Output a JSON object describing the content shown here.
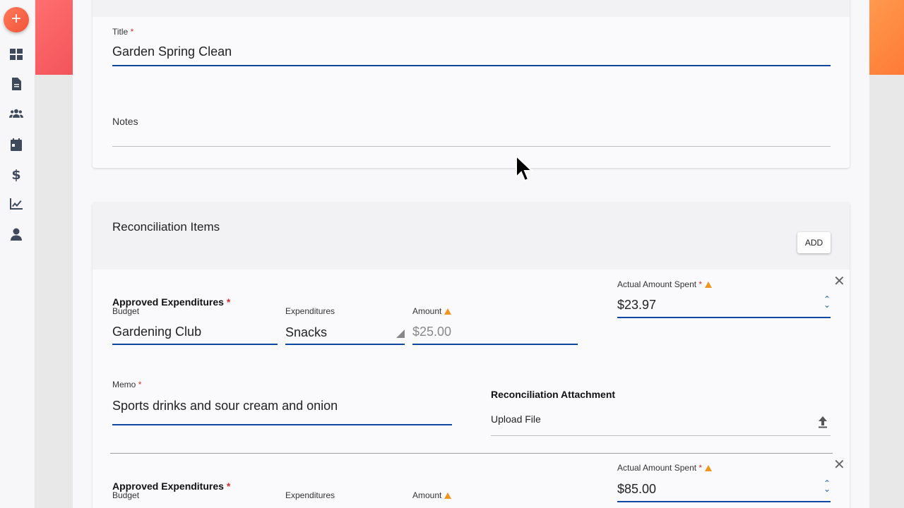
{
  "sidebar": {
    "fab_symbol": "+",
    "icons": [
      "dashboard-icon",
      "document-icon",
      "people-icon",
      "calendar-icon",
      "dollar-icon",
      "chart-icon",
      "person-icon"
    ]
  },
  "event": {
    "title_label": "Title",
    "title_value": "Garden Spring Clean",
    "notes_label": "Notes",
    "notes_value": ""
  },
  "reconciliation": {
    "title": "Reconciliation Items",
    "add_label": "ADD",
    "items": [
      {
        "approved_label": "Approved Expenditures",
        "budget_label": "Budget",
        "budget_value": "Gardening Club",
        "expenditures_label": "Expenditures",
        "expenditures_value": "Snacks",
        "amount_label": "Amount",
        "amount_value": "$25.00",
        "actual_label": "Actual Amount Spent",
        "actual_value": "$23.97",
        "memo_label": "Memo",
        "memo_value": "Sports drinks and sour cream and onion",
        "attachment_label": "Reconciliation Attachment",
        "upload_label": "Upload File"
      },
      {
        "approved_label": "Approved Expenditures",
        "budget_label": "Budget",
        "expenditures_label": "Expenditures",
        "amount_label": "Amount",
        "actual_label": "Actual Amount Spent",
        "actual_value": "$85.00"
      }
    ]
  },
  "colors": {
    "accent_blue": "#0d47a1",
    "warning": "#f0961e",
    "required": "#d32f2f",
    "fab": "#f2533a"
  }
}
